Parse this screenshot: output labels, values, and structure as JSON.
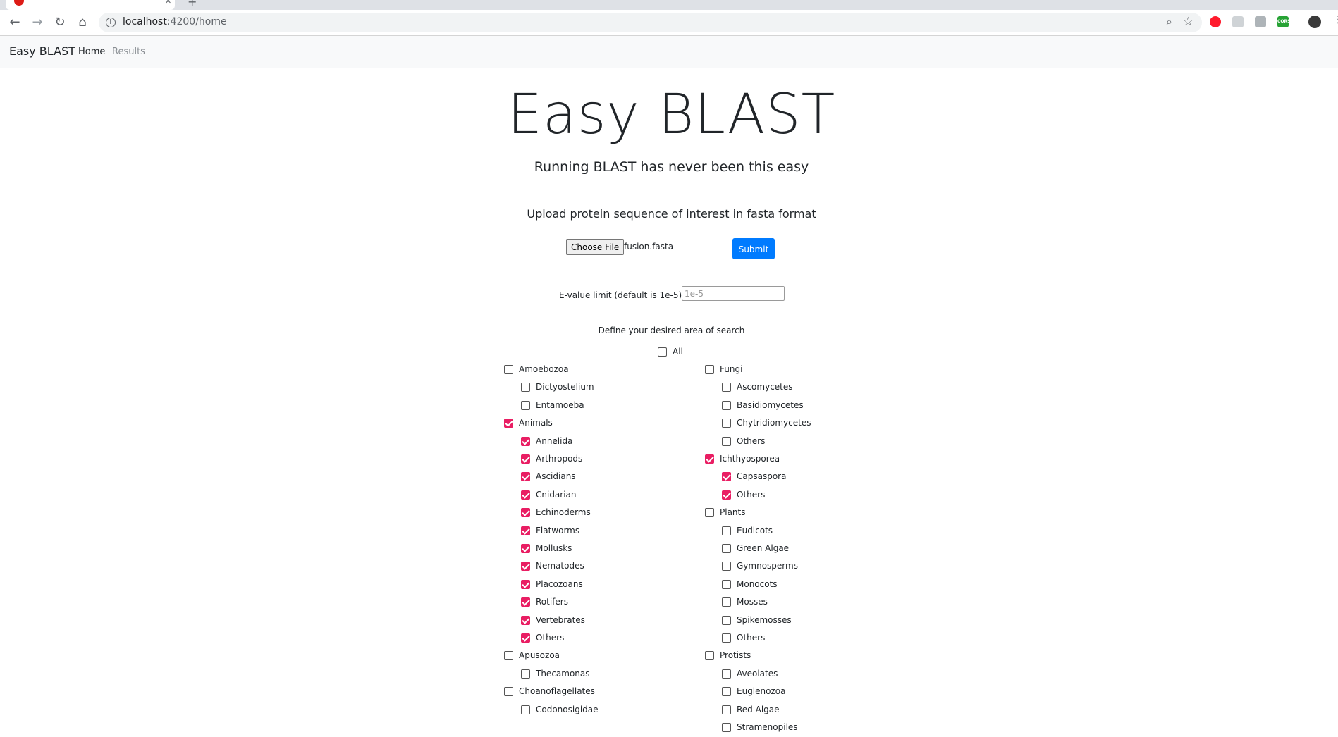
{
  "browser": {
    "url_host": "localhost",
    "url_path": ":4200/home"
  },
  "navbar": {
    "brand": "Easy BLAST",
    "home": "Home",
    "results": "Results"
  },
  "main": {
    "title": "Easy BLAST",
    "subtitle": "Running BLAST has never been this easy",
    "upload_label": "Upload protein sequence of interest in fasta format",
    "choose_file_label": "Choose File",
    "file_name": "fusion.fasta",
    "submit_label": "Submit",
    "evalue_label": "E-value limit (default is 1e-5)",
    "evalue_placeholder": "1e-5",
    "define_label": "Define your desired area of search",
    "all_label": "All"
  },
  "colors": {
    "checked": "#e91e63",
    "submit": "#007bff"
  },
  "left_column": [
    {
      "label": "Amoebozoa",
      "checked": false,
      "child": false
    },
    {
      "label": "Dictyostelium",
      "checked": false,
      "child": true
    },
    {
      "label": "Entamoeba",
      "checked": false,
      "child": true
    },
    {
      "label": "Animals",
      "checked": true,
      "child": false
    },
    {
      "label": "Annelida",
      "checked": true,
      "child": true
    },
    {
      "label": "Arthropods",
      "checked": true,
      "child": true
    },
    {
      "label": "Ascidians",
      "checked": true,
      "child": true
    },
    {
      "label": "Cnidarian",
      "checked": true,
      "child": true
    },
    {
      "label": "Echinoderms",
      "checked": true,
      "child": true
    },
    {
      "label": "Flatworms",
      "checked": true,
      "child": true
    },
    {
      "label": "Mollusks",
      "checked": true,
      "child": true
    },
    {
      "label": "Nematodes",
      "checked": true,
      "child": true
    },
    {
      "label": "Placozoans",
      "checked": true,
      "child": true
    },
    {
      "label": "Rotifers",
      "checked": true,
      "child": true
    },
    {
      "label": "Vertebrates",
      "checked": true,
      "child": true
    },
    {
      "label": "Others",
      "checked": true,
      "child": true
    },
    {
      "label": "Apusozoa",
      "checked": false,
      "child": false
    },
    {
      "label": "Thecamonas",
      "checked": false,
      "child": true
    },
    {
      "label": "Choanoflagellates",
      "checked": false,
      "child": false
    },
    {
      "label": "Codonosigidae",
      "checked": false,
      "child": true
    }
  ],
  "right_column": [
    {
      "label": "Fungi",
      "checked": false,
      "child": false
    },
    {
      "label": "Ascomycetes",
      "checked": false,
      "child": true
    },
    {
      "label": "Basidiomycetes",
      "checked": false,
      "child": true
    },
    {
      "label": "Chytridiomycetes",
      "checked": false,
      "child": true
    },
    {
      "label": "Others",
      "checked": false,
      "child": true
    },
    {
      "label": "Ichthyosporea",
      "checked": true,
      "child": false
    },
    {
      "label": "Capsaspora",
      "checked": true,
      "child": true
    },
    {
      "label": "Others",
      "checked": true,
      "child": true
    },
    {
      "label": "Plants",
      "checked": false,
      "child": false
    },
    {
      "label": "Eudicots",
      "checked": false,
      "child": true
    },
    {
      "label": "Green Algae",
      "checked": false,
      "child": true
    },
    {
      "label": "Gymnosperms",
      "checked": false,
      "child": true
    },
    {
      "label": "Monocots",
      "checked": false,
      "child": true
    },
    {
      "label": "Mosses",
      "checked": false,
      "child": true
    },
    {
      "label": "Spikemosses",
      "checked": false,
      "child": true
    },
    {
      "label": "Others",
      "checked": false,
      "child": true
    },
    {
      "label": "Protists",
      "checked": false,
      "child": false
    },
    {
      "label": "Aveolates",
      "checked": false,
      "child": true
    },
    {
      "label": "Euglenozoa",
      "checked": false,
      "child": true
    },
    {
      "label": "Red Algae",
      "checked": false,
      "child": true
    },
    {
      "label": "Stramenopiles",
      "checked": false,
      "child": true
    }
  ]
}
